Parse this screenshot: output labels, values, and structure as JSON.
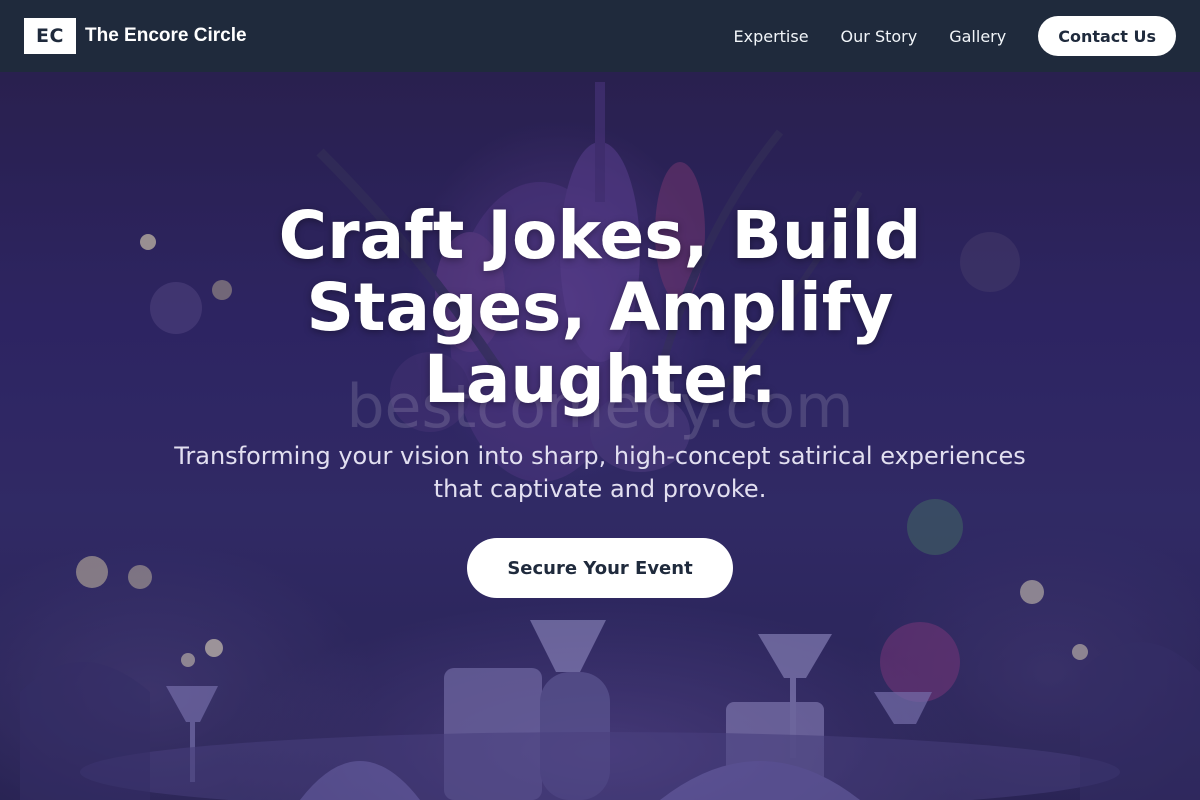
{
  "header": {
    "logo_text": "EC",
    "brand_name": "The Encore Circle",
    "nav": [
      "Expertise",
      "Our Story",
      "Gallery"
    ],
    "contact_label": "Contact Us"
  },
  "hero": {
    "headline": "Craft Jokes, Build Stages, Amplify Laughter.",
    "subtext": "Transforming your vision into sharp, high-concept satirical experiences that captivate and provoke.",
    "cta_label": "Secure Your Event",
    "watermark": "bestcomedy.com"
  },
  "colors": {
    "header_bg": "#1f2a3c",
    "hero_tint": "#31296a",
    "button_bg": "#ffffff",
    "button_text": "#1f2a3c"
  }
}
